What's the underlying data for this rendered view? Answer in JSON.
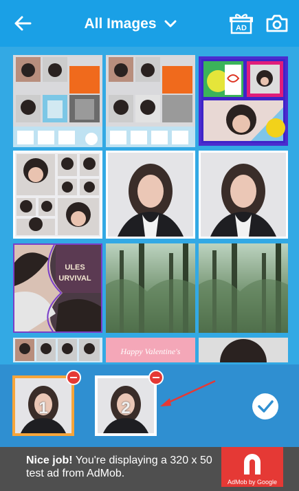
{
  "header": {
    "title": "All Images",
    "icons": {
      "back": "arrow-left-icon",
      "dropdown": "chevron-down-icon",
      "ad_gift": "gift-ad-icon",
      "camera": "camera-icon"
    },
    "ad_gift_label": "AD"
  },
  "gallery": {
    "tiles": [
      {
        "kind": "collage-grid"
      },
      {
        "kind": "collage-grid"
      },
      {
        "kind": "collage-stickers"
      },
      {
        "kind": "photo-collage"
      },
      {
        "kind": "portrait"
      },
      {
        "kind": "portrait"
      },
      {
        "kind": "curved-collage"
      },
      {
        "kind": "forest"
      },
      {
        "kind": "forest"
      },
      {
        "kind": "collage-grid"
      },
      {
        "kind": "valentine"
      },
      {
        "kind": "portrait-dark"
      }
    ],
    "valentine_text": "Happy Valentine's"
  },
  "tray": {
    "selected": [
      {
        "number": "1",
        "border_color": "#f6a53a"
      },
      {
        "number": "2",
        "border_color": "#ffffff"
      }
    ],
    "confirm_icon": "checkmark-icon"
  },
  "ad": {
    "headline": "Nice job!",
    "body": " You're displaying a 320 x 50 test ad from AdMob.",
    "logo_caption": "AdMob by Google"
  },
  "colors": {
    "header": "#1aa0e6",
    "background": "#2ea6e2",
    "tray": "#2f8fd1",
    "remove": "#e53935",
    "selected_orange": "#f6a53a",
    "ad_background": "#4f4f4f",
    "arrow": "#e53935"
  }
}
